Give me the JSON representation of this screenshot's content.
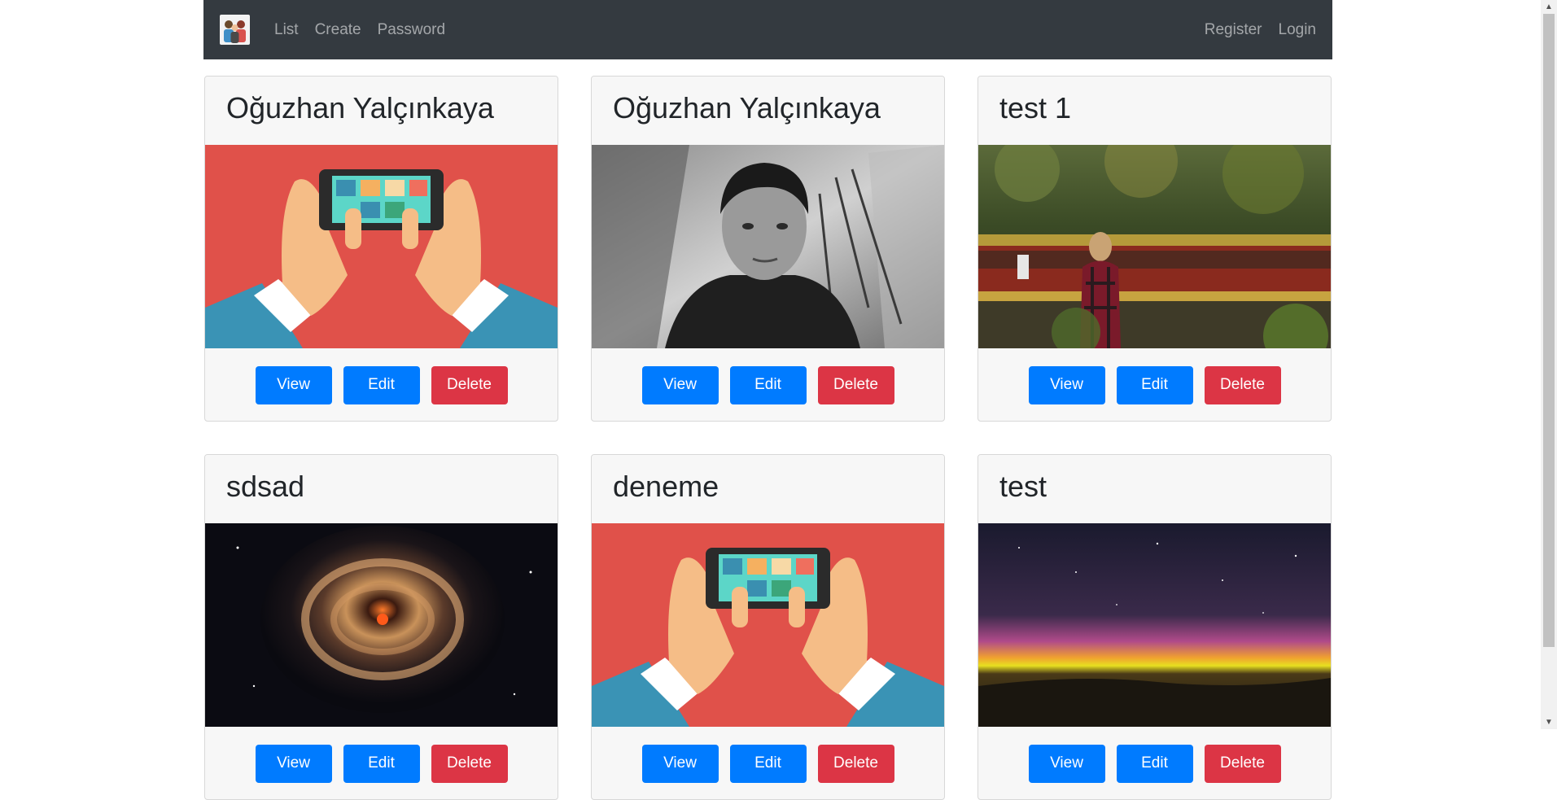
{
  "navbar": {
    "brand_icon": "people-group-logo",
    "links": [
      "List",
      "Create",
      "Password"
    ],
    "right_links": [
      "Register",
      "Login"
    ]
  },
  "cards": [
    {
      "title": "Oğuzhan Yalçınkaya",
      "image": "hands-holding-phone-illustration",
      "view": "View",
      "edit": "Edit",
      "delete": "Delete"
    },
    {
      "title": "Oğuzhan Yalçınkaya",
      "image": "black-and-white-portrait-photo",
      "view": "View",
      "edit": "Edit",
      "delete": "Delete"
    },
    {
      "title": "test 1",
      "image": "girl-watching-train-photo",
      "view": "View",
      "edit": "Edit",
      "delete": "Delete"
    },
    {
      "title": "sdsad",
      "image": "galaxy-ring-photo",
      "view": "View",
      "edit": "Edit",
      "delete": "Delete"
    },
    {
      "title": "deneme",
      "image": "hands-holding-phone-illustration",
      "view": "View",
      "edit": "Edit",
      "delete": "Delete"
    },
    {
      "title": "test",
      "image": "aurora-night-sky-photo",
      "view": "View",
      "edit": "Edit",
      "delete": "Delete"
    }
  ],
  "colors": {
    "navbar_bg": "#343a40",
    "primary": "#007bff",
    "danger": "#dc3545",
    "card_bg": "#f7f7f7"
  }
}
